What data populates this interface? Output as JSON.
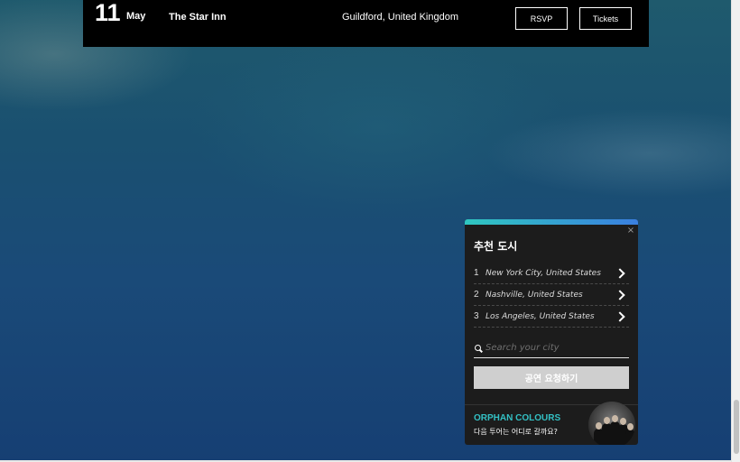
{
  "tour": {
    "day": "11",
    "month": "May",
    "venue": "The Star Inn",
    "location": "Guildford, United Kingdom",
    "rsvp_label": "RSVP",
    "tickets_label": "Tickets"
  },
  "widget": {
    "title": "추천 도시",
    "close_icon": "×",
    "cities": [
      {
        "rank": "1",
        "name": "New York City, United States"
      },
      {
        "rank": "2",
        "name": "Nashville, United States"
      },
      {
        "rank": "3",
        "name": "Los Angeles, United States"
      }
    ],
    "search_placeholder": "Search your city",
    "request_button": "공연 요청하기",
    "artist_name": "ORPHAN COLOURS",
    "artist_prompt": "다음 투어는 어디로 갈까요?",
    "colors": {
      "accent_teal": "#33c0c4",
      "gradient_start": "#2fc7c0",
      "gradient_end": "#3a7fe0"
    }
  }
}
